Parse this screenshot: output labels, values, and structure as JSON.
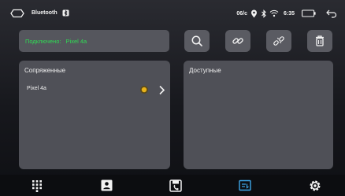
{
  "status_bar": {
    "title": "Bluetooth",
    "indicator": "06/c",
    "time": "6:35",
    "icons": [
      "home-icon",
      "bluetooth-badge-icon",
      "location-pin-icon",
      "bluetooth-icon",
      "wifi-icon",
      "battery-icon",
      "back-icon"
    ]
  },
  "connection": {
    "label": "Подключено:",
    "device": "Pixel 4a",
    "color": "#2fdc54"
  },
  "actions": [
    {
      "icon": "search-icon"
    },
    {
      "icon": "link-icon"
    },
    {
      "icon": "unlink-icon"
    },
    {
      "icon": "trash-icon"
    }
  ],
  "paired_panel": {
    "title": "Сопряженные",
    "devices": [
      {
        "name": "Pixel 4a",
        "status_color": "#e8b21a"
      }
    ]
  },
  "available_panel": {
    "title": "Доступные",
    "devices": []
  },
  "bottom_nav": {
    "items": [
      {
        "icon": "dialpad-icon",
        "active": false
      },
      {
        "icon": "contacts-icon",
        "active": false
      },
      {
        "icon": "call-log-icon",
        "active": false
      },
      {
        "icon": "bluetooth-music-icon",
        "active": true
      },
      {
        "icon": "settings-icon",
        "active": false
      }
    ],
    "active_color": "#3ea6e8"
  }
}
